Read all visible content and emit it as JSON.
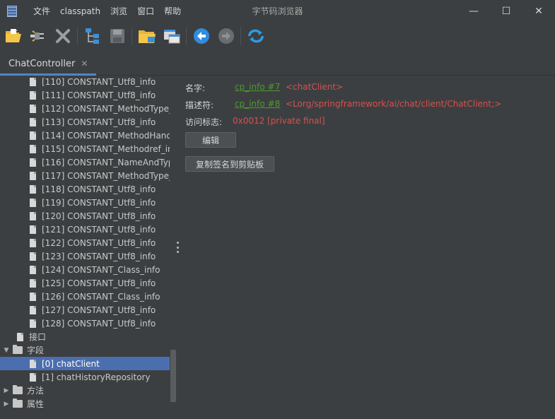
{
  "menu": [
    "文件",
    "classpath",
    "浏览",
    "窗口",
    "帮助"
  ],
  "window_title": "字节码浏览器",
  "window_controls": {
    "minimize": "—",
    "maximize": "☐",
    "close": "✕"
  },
  "toolbar": [
    {
      "icon": "open-folder-icon"
    },
    {
      "icon": "plug-icon"
    },
    {
      "icon": "close-x-icon"
    },
    {
      "icon": "hierarchy-icon"
    },
    {
      "icon": "save-icon"
    },
    {
      "icon": "open-classes-icon"
    },
    {
      "icon": "window-icon"
    },
    {
      "icon": "back-arrow-icon"
    },
    {
      "icon": "forward-arrow-icon"
    },
    {
      "icon": "refresh-icon"
    }
  ],
  "tab": {
    "label": "ChatController",
    "close": "✕"
  },
  "tree": {
    "constants": [
      "[110] CONSTANT_Utf8_info",
      "[111] CONSTANT_Utf8_info",
      "[112] CONSTANT_MethodType_",
      "[113] CONSTANT_Utf8_info",
      "[114] CONSTANT_MethodHand",
      "[115] CONSTANT_Methodref_in",
      "[116] CONSTANT_NameAndTyp",
      "[117] CONSTANT_MethodType_",
      "[118] CONSTANT_Utf8_info",
      "[119] CONSTANT_Utf8_info",
      "[120] CONSTANT_Utf8_info",
      "[121] CONSTANT_Utf8_info",
      "[122] CONSTANT_Utf8_info",
      "[123] CONSTANT_Utf8_info",
      "[124] CONSTANT_Class_info",
      "[125] CONSTANT_Utf8_info",
      "[126] CONSTANT_Class_info",
      "[127] CONSTANT_Utf8_info",
      "[128] CONSTANT_Utf8_info"
    ],
    "interfaces_label": "接口",
    "fields_label": "字段",
    "fields": [
      "[0] chatClient",
      "[1] chatHistoryRepository"
    ],
    "methods_label": "方法",
    "attributes_label": "属性",
    "expand_arrow": "▶",
    "collapse_arrow": "▼"
  },
  "detail": {
    "name_label": "名字:",
    "name_link": "cp_info #7",
    "name_value": "<chatClient>",
    "descriptor_label": "描述符:",
    "descriptor_link": "cp_info #8",
    "descriptor_value": "<Lorg/springframework/ai/chat/client/ChatClient;>",
    "access_label": "访问标志:",
    "access_value": "0x0012 [private final]",
    "edit_button": "编辑",
    "copy_button": "复制签名到剪贴板"
  },
  "colors": {
    "selection": "#4b6eaf",
    "link": "#4e9a2f",
    "value": "#d65050",
    "tab_underline": "#4a88c7"
  }
}
